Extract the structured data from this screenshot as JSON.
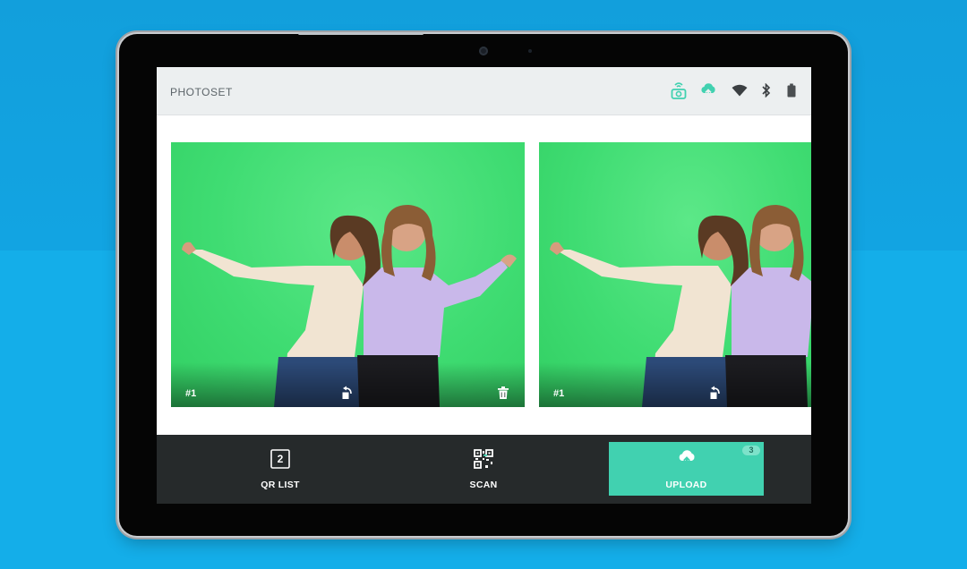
{
  "app": {
    "title": "PHOTOSET"
  },
  "status_icons": [
    "camera-wifi-icon",
    "cloud-upload-icon",
    "wifi-icon",
    "bluetooth-icon",
    "battery-icon"
  ],
  "photos": [
    {
      "number": "#1"
    },
    {
      "number": "#1"
    }
  ],
  "bottom_bar": {
    "qr_list": {
      "label": "QR LIST",
      "count": "2"
    },
    "scan": {
      "label": "SCAN"
    },
    "upload": {
      "label": "UPLOAD",
      "badge": "3"
    }
  },
  "colors": {
    "accent": "#41d1b0",
    "topbar": "#eceff0",
    "bottombar": "#262a2b",
    "background": "#14aee9"
  }
}
